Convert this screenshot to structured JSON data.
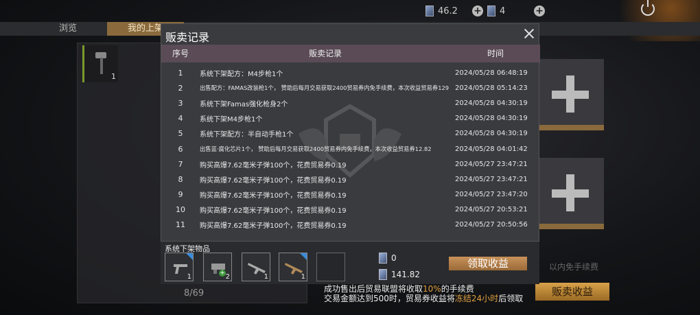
{
  "topbar": {
    "resource1": "46.2",
    "resource2": "4"
  },
  "tabs": [
    {
      "label": "浏览"
    },
    {
      "label": "我的上架"
    }
  ],
  "left_panel": {
    "slot_qty": "1",
    "page_count": "8/69"
  },
  "background": {
    "hint": "以内免手续费",
    "sell_button": "贩卖收益"
  },
  "modal": {
    "title": "贩卖记录",
    "headers": {
      "index": "序号",
      "record": "贩卖记录",
      "time": "时间"
    },
    "rows": [
      {
        "n": "1",
        "desc": "系统下架配方：M4步枪1个",
        "time": "2024/05/28 06:48:19"
      },
      {
        "n": "2",
        "desc": "出售配方：FAMAS改装枪1个， 赞助后每月交易获取2400贸易券内免手续费，本次收益贸易券129",
        "time": "2024/05/28 05:14:23"
      },
      {
        "n": "3",
        "desc": "系统下架Famas强化枪身2个",
        "time": "2024/05/28 04:30:19"
      },
      {
        "n": "4",
        "desc": "系统下架M4步枪1个",
        "time": "2024/05/28 04:30:19"
      },
      {
        "n": "5",
        "desc": "系统下架配方：半自动手枪1个",
        "time": "2024/05/28 04:30:19"
      },
      {
        "n": "6",
        "desc": "出售蓝·腐化芯片1个， 赞助后每月交易获取2400贸易券内免手续费，本次收益贸易券12.82",
        "time": "2024/05/28 04:01:42"
      },
      {
        "n": "7",
        "desc": "购买高爆7.62毫米子弹100个，花费贸易券0.19",
        "time": "2024/05/27 23:47:21"
      },
      {
        "n": "8",
        "desc": "购买高爆7.62毫米子弹100个，花费贸易券0.19",
        "time": "2024/05/27 23:47:21"
      },
      {
        "n": "9",
        "desc": "购买高爆7.62毫米子弹100个，花费贸易券0.19",
        "time": "2024/05/27 23:47:20"
      },
      {
        "n": "10",
        "desc": "购买高爆7.62毫米子弹100个，花费贸易券0.19",
        "time": "2024/05/27 20:53:21"
      },
      {
        "n": "11",
        "desc": "购买高爆7.62毫米子弹100个，花费贸易券0.19",
        "time": "2024/05/27 20:50:56"
      }
    ]
  },
  "delisted": {
    "label": "系统下架物品",
    "items": [
      {
        "qty": "1"
      },
      {
        "qty": "2"
      },
      {
        "qty": "1"
      },
      {
        "qty": "1"
      }
    ],
    "money1": "0",
    "money2": "141.82",
    "claim_button": "领取收益"
  },
  "note": {
    "line1_a": "成功售出后贸易联盟将收取",
    "line1_pct": "10%",
    "line1_b": "的手续费",
    "line2_a": "交易金额达到500时，贸易券收益将",
    "line2_hl": "冻结24小时",
    "line2_b": "后领取"
  },
  "colors": {
    "accent": "#8a6a3c",
    "header": "#5a4b56",
    "highlight": "#e0a040",
    "rarity_blue": "#3a8ad8"
  },
  "icons": [
    "ticket-icon",
    "plus-icon",
    "power-icon",
    "close-icon",
    "hammer-icon",
    "pistol-icon",
    "gun-part-icon",
    "rifle-icon"
  ]
}
